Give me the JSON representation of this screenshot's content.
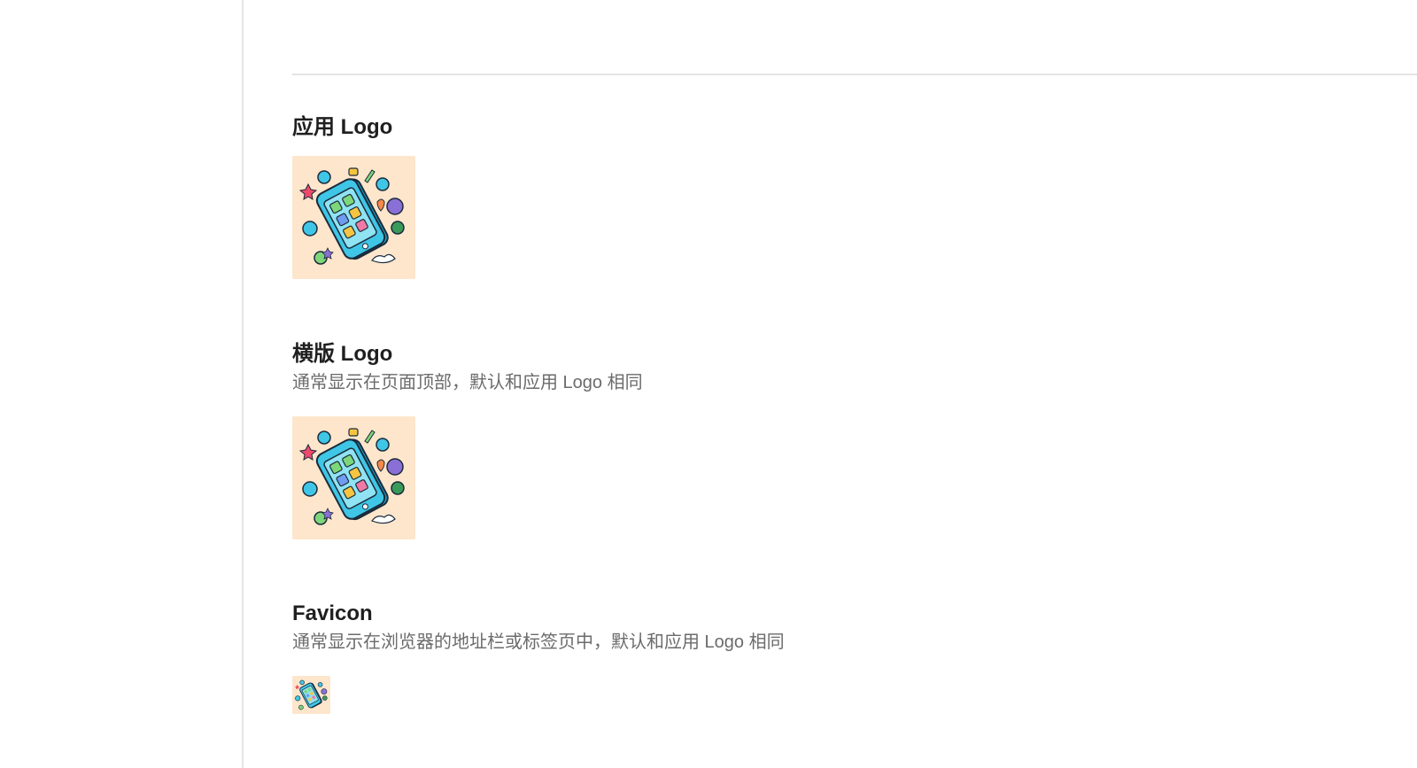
{
  "sections": [
    {
      "title": "应用 Logo",
      "description": ""
    },
    {
      "title": "横版 Logo",
      "description": "通常显示在页面顶部，默认和应用 Logo 相同"
    },
    {
      "title": "Favicon",
      "description": "通常显示在浏览器的地址栏或标签页中，默认和应用 Logo 相同"
    }
  ],
  "icons": {
    "logo": "smartphone-apps-illustration-icon"
  },
  "colors": {
    "logo_background": "#fde6cc",
    "phone_body": "#3fc6e6",
    "divider": "#e3e3e3",
    "description_text": "#6b6b6b"
  }
}
